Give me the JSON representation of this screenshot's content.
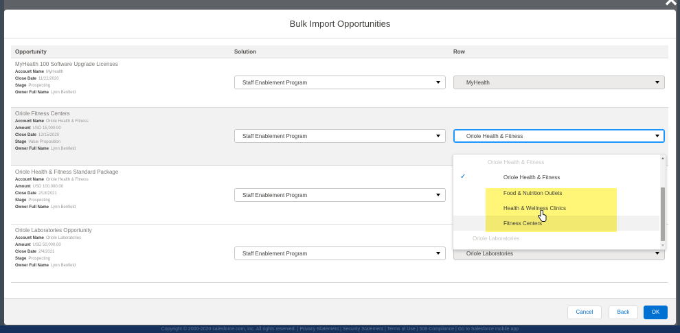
{
  "modal": {
    "title": "Bulk Import Opportunities",
    "close_glyph": "✕"
  },
  "table": {
    "headers": [
      "Opportunity",
      "Solution",
      "Row"
    ],
    "rows": [
      {
        "title": "MyHealth 100 Software Upgrade Licenses",
        "fields": [
          {
            "label": "Account Name",
            "value": "MyHealth"
          },
          {
            "label": "Close Date",
            "value": "11/22/2020"
          },
          {
            "label": "Stage",
            "value": "Prospecting"
          },
          {
            "label": "Owner Full Name",
            "value": "Lynn Benfield"
          }
        ],
        "solution": "Staff Enablement Program",
        "row_value": "MyHealth"
      },
      {
        "title": "Oriole Fitness Centers",
        "fields": [
          {
            "label": "Account Name",
            "value": "Oriole Health & Fitness"
          },
          {
            "label": "Amount",
            "value": "USD 15,000.00"
          },
          {
            "label": "Close Date",
            "value": "12/15/2020"
          },
          {
            "label": "Stage",
            "value": "Value Proposition"
          },
          {
            "label": "Owner Full Name",
            "value": "Lynn Benfield"
          }
        ],
        "solution": "Staff Enablement Program",
        "row_value": "Oriole Health & Fitness"
      },
      {
        "title": "Oriole Health & Fitness Standard Package",
        "fields": [
          {
            "label": "Account Name",
            "value": "Oriole Health & Fitness"
          },
          {
            "label": "Amount",
            "value": "USD 100,000.00"
          },
          {
            "label": "Close Date",
            "value": "2/18/2021"
          },
          {
            "label": "Stage",
            "value": "Prospecting"
          },
          {
            "label": "Owner Full Name",
            "value": "Lynn Benfield"
          }
        ],
        "solution": "Staff Enablement Program",
        "row_value": ""
      },
      {
        "title": "Oriole Laboratories Opportunity",
        "fields": [
          {
            "label": "Account Name",
            "value": "Oriole Laboratories"
          },
          {
            "label": "Amount",
            "value": "USD 50,000.00"
          },
          {
            "label": "Close Date",
            "value": "2/4/2021"
          },
          {
            "label": "Stage",
            "value": "Prospecting"
          },
          {
            "label": "Owner Full Name",
            "value": "Lynn Benfield"
          }
        ],
        "solution": "Staff Enablement Program",
        "row_value": "Oriole Laboratories"
      }
    ]
  },
  "dropdown": {
    "options": [
      {
        "label": "Oriole Health & Fitness",
        "disabled": true
      },
      {
        "label": "Oriole Health & Fitness",
        "selected": true
      },
      {
        "label": "Food & Nutrition Outlets"
      },
      {
        "label": "Health & Wellness Clinics"
      },
      {
        "label": "Fitness Centers",
        "hovered": true
      },
      {
        "label": "Oriole Laboratories",
        "disabled": true
      }
    ],
    "highlight_color": "#fff568"
  },
  "footer": {
    "cancel": "Cancel",
    "back": "Back",
    "ok": "OK"
  },
  "page_footer": {
    "text": "Copyright © 2000-2020 salesforce.com, inc. All rights reserved. | Privacy Statement | Security Statement | Terms of Use | 508 Compliance | Go to Salesforce mobile app"
  },
  "colors": {
    "brand": "#0070d2",
    "focus": "#1b96ff",
    "footer_bar": "#16325c"
  }
}
